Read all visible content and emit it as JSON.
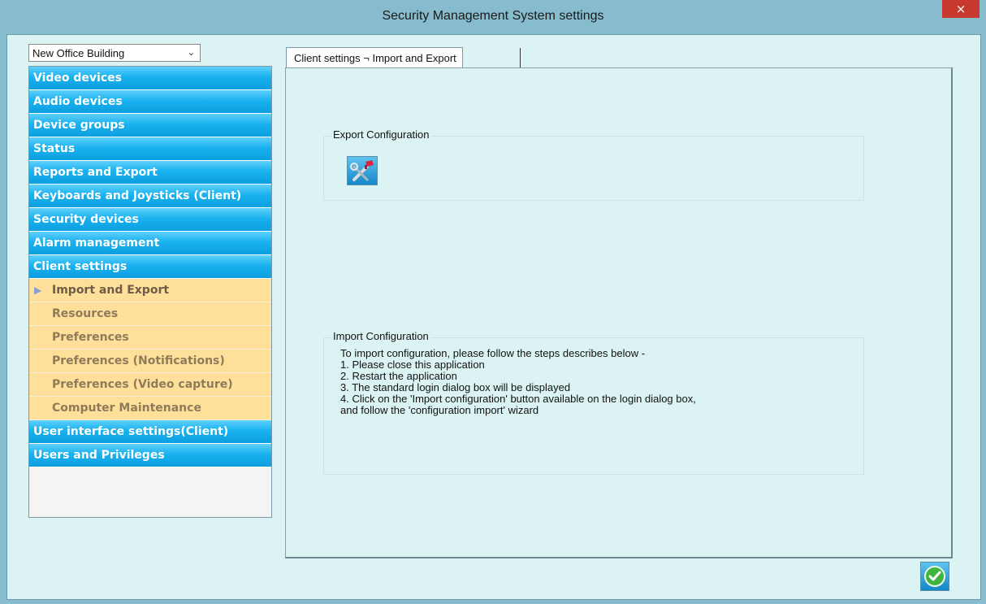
{
  "window": {
    "title": "Security Management System settings",
    "close_glyph": "×"
  },
  "site_selector": {
    "value": "New Office Building",
    "arrow": "⌄"
  },
  "sidebar": {
    "categories_top": [
      {
        "label": "Video devices"
      },
      {
        "label": "Audio devices"
      },
      {
        "label": "Device groups"
      },
      {
        "label": "Status"
      },
      {
        "label": "Reports and Export"
      },
      {
        "label": "Keyboards and Joysticks (Client)"
      },
      {
        "label": "Security devices"
      },
      {
        "label": "Alarm management"
      },
      {
        "label": "Client settings"
      }
    ],
    "subitems": [
      {
        "label": "Import and Export",
        "active": true
      },
      {
        "label": "Resources"
      },
      {
        "label": "Preferences"
      },
      {
        "label": "Preferences (Notifications)"
      },
      {
        "label": "Preferences (Video capture)"
      },
      {
        "label": "Computer Maintenance"
      }
    ],
    "categories_bottom": [
      {
        "label": "User interface settings(Client)"
      },
      {
        "label": "Users and Privileges"
      }
    ],
    "active_marker": "▶"
  },
  "tab": {
    "label": "Client settings ¬ Import and Export"
  },
  "export_group": {
    "legend": "Export Configuration",
    "button_icon": "tools-icon"
  },
  "import_group": {
    "legend": "Import Configuration",
    "lines": [
      "To import configuration, please follow the steps describes below -",
      "1. Please close this application",
      "2. Restart the application",
      "3. The standard login dialog box will be displayed",
      "4. Click on the 'Import configuration' button available on the login dialog box,",
      "and follow the 'configuration import' wizard"
    ]
  },
  "footer": {
    "ok_icon": "checkmark-icon"
  },
  "colors": {
    "frame": "#86bccd",
    "client_bg": "#dcf3f3",
    "category_blue": "#1ab1ef",
    "subitem_yellow": "#ffe09b",
    "close_red": "#c7392f",
    "ok_green": "#3fb53f"
  }
}
